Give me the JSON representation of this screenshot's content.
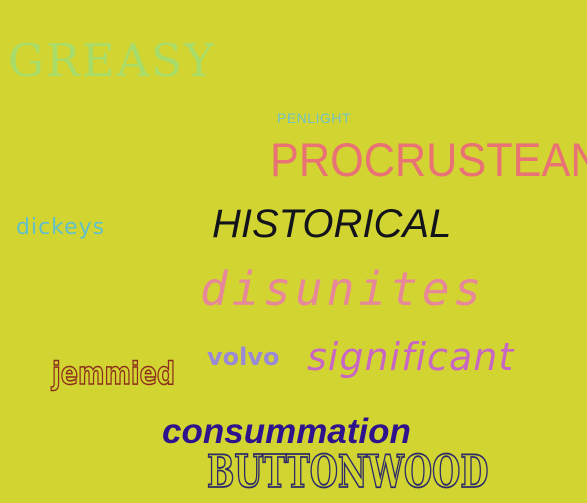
{
  "words": {
    "greasy": "GREASY",
    "penlight": "PENLIGHT",
    "procrustean": "PROCRUSTEAN",
    "dickeys": "dickeys",
    "historical": "HISTORICAL",
    "disunites": "disunites",
    "jemmied": "jemmied",
    "volvo": "volvo",
    "significant": "significant",
    "consummation": "consummation",
    "buttonwood": "BUTTONWOOD"
  },
  "colors": {
    "background": "#d2d531",
    "greasy": "#a8dc6a",
    "penlight": "#74c2c6",
    "procrustean": "#e87274",
    "dickeys": "#62c0c8",
    "historical": "#13131b",
    "disunites": "#e6879a",
    "jemmied": "#8b2d1c",
    "volvo": "#9a8ad6",
    "significant": "#c866c4",
    "consummation": "#2e138c",
    "buttonwood": "#2d2a6a"
  }
}
